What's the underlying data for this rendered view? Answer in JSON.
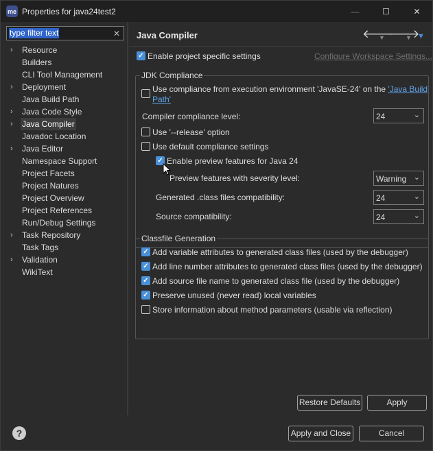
{
  "window": {
    "icon_text": "me",
    "title": "Properties for java24test2",
    "minimize_glyph": "—",
    "maximize_glyph": "☐",
    "close_glyph": "✕"
  },
  "filter": {
    "value": "type filter text",
    "clear_glyph": "✕"
  },
  "tree": [
    {
      "label": "Resource",
      "expandable": true,
      "selected": false
    },
    {
      "label": "Builders",
      "expandable": false,
      "selected": false
    },
    {
      "label": "CLI Tool Management",
      "expandable": false,
      "selected": false
    },
    {
      "label": "Deployment",
      "expandable": true,
      "selected": false
    },
    {
      "label": "Java Build Path",
      "expandable": false,
      "selected": false
    },
    {
      "label": "Java Code Style",
      "expandable": true,
      "selected": false
    },
    {
      "label": "Java Compiler",
      "expandable": true,
      "selected": true
    },
    {
      "label": "Javadoc Location",
      "expandable": false,
      "selected": false
    },
    {
      "label": "Java Editor",
      "expandable": true,
      "selected": false
    },
    {
      "label": "Namespace Support",
      "expandable": false,
      "selected": false
    },
    {
      "label": "Project Facets",
      "expandable": false,
      "selected": false
    },
    {
      "label": "Project Natures",
      "expandable": false,
      "selected": false
    },
    {
      "label": "Project Overview",
      "expandable": false,
      "selected": false
    },
    {
      "label": "Project References",
      "expandable": false,
      "selected": false
    },
    {
      "label": "Run/Debug Settings",
      "expandable": false,
      "selected": false
    },
    {
      "label": "Task Repository",
      "expandable": true,
      "selected": false
    },
    {
      "label": "Task Tags",
      "expandable": false,
      "selected": false
    },
    {
      "label": "Validation",
      "expandable": true,
      "selected": false
    },
    {
      "label": "WikiText",
      "expandable": false,
      "selected": false
    }
  ],
  "page": {
    "title": "Java Compiler",
    "back_glyph": "🡐",
    "forward_glyph": "🡒",
    "dropdown_glyph": "▼",
    "enable_project_specific": {
      "label": "Enable project specific settings",
      "checked": true
    },
    "configure_workspace_link": "Configure Workspace Settings...",
    "jdk": {
      "legend": "JDK Compliance",
      "use_compliance_line1_prefix": "Use compliance from execution environment 'JavaSE-24' on the ",
      "use_compliance_link1": "'Java Build",
      "use_compliance_link2": "Path'",
      "use_compliance_checked": false,
      "compliance_level_label": "Compiler compliance level:",
      "compliance_level_value": "24",
      "use_release": {
        "label": "Use '--release' option",
        "checked": false
      },
      "use_default": {
        "label": "Use default compliance settings",
        "checked": false
      },
      "enable_preview": {
        "label": "Enable preview features for Java 24",
        "checked": true
      },
      "preview_severity_label": "Preview features with severity level:",
      "preview_severity_value": "Warning",
      "generated_class_label": "Generated .class files compatibility:",
      "generated_class_value": "24",
      "source_compat_label": "Source compatibility:",
      "source_compat_value": "24"
    },
    "classfile": {
      "legend": "Classfile Generation",
      "options": [
        {
          "label": "Add variable attributes to generated class files (used by the debugger)",
          "checked": true
        },
        {
          "label": "Add line number attributes to generated class files (used by the debugger)",
          "checked": true
        },
        {
          "label": "Add source file name to generated class file (used by the debugger)",
          "checked": true
        },
        {
          "label": "Preserve unused (never read) local variables",
          "checked": true
        },
        {
          "label": "Store information about method parameters (usable via reflection)",
          "checked": false
        }
      ]
    },
    "restore_defaults_label": "Restore Defaults",
    "apply_label": "Apply"
  },
  "footer": {
    "help_glyph": "?",
    "apply_close_label": "Apply and Close",
    "cancel_label": "Cancel"
  },
  "check_glyph": "✓",
  "combo_arrow_glyph": "⌄",
  "tree_chevron_glyph": "›",
  "colors": {
    "accent": "#4a90d9",
    "selection": "#2f65ca",
    "link": "#5fa3e8",
    "background": "#2b2b2b"
  }
}
